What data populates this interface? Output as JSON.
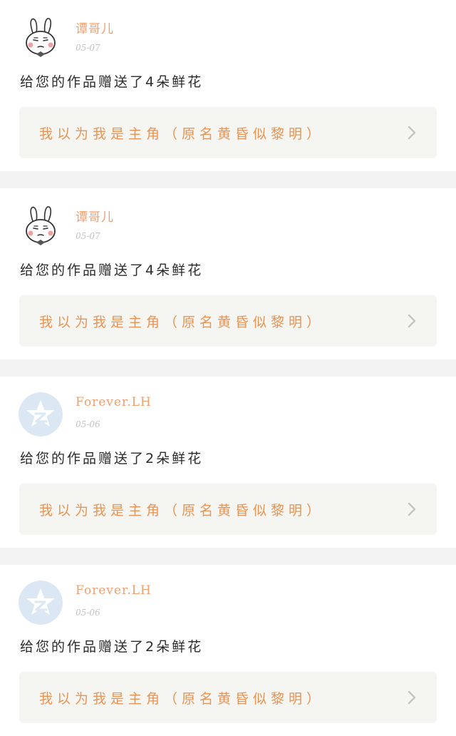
{
  "colors": {
    "accent_orange": "#e89456",
    "name_orange": "#f0a071",
    "timestamp_gray": "#c4c4c4",
    "card_bg": "#f5f5f1",
    "divider_gray": "#f3f3f3",
    "chevron_gray": "#c4c4c4"
  },
  "notifications": [
    {
      "avatar_icon": "rabbit-avatar-icon",
      "user_name": "谭哥儿",
      "timestamp": "05-07",
      "message": "给您的作品赠送了4朵鲜花",
      "work_title": "我以为我是主角（原名黄昏似黎明）"
    },
    {
      "avatar_icon": "rabbit-avatar-icon",
      "user_name": "谭哥儿",
      "timestamp": "05-07",
      "message": "给您的作品赠送了4朵鲜花",
      "work_title": "我以为我是主角（原名黄昏似黎明）"
    },
    {
      "avatar_icon": "qzone-star-avatar-icon",
      "user_name": "Forever.LH",
      "timestamp": "05-06",
      "message": "给您的作品赠送了2朵鲜花",
      "work_title": "我以为我是主角（原名黄昏似黎明）"
    },
    {
      "avatar_icon": "qzone-star-avatar-icon",
      "user_name": "Forever.LH",
      "timestamp": "05-06",
      "message": "给您的作品赠送了2朵鲜花",
      "work_title": "我以为我是主角（原名黄昏似黎明）"
    }
  ]
}
